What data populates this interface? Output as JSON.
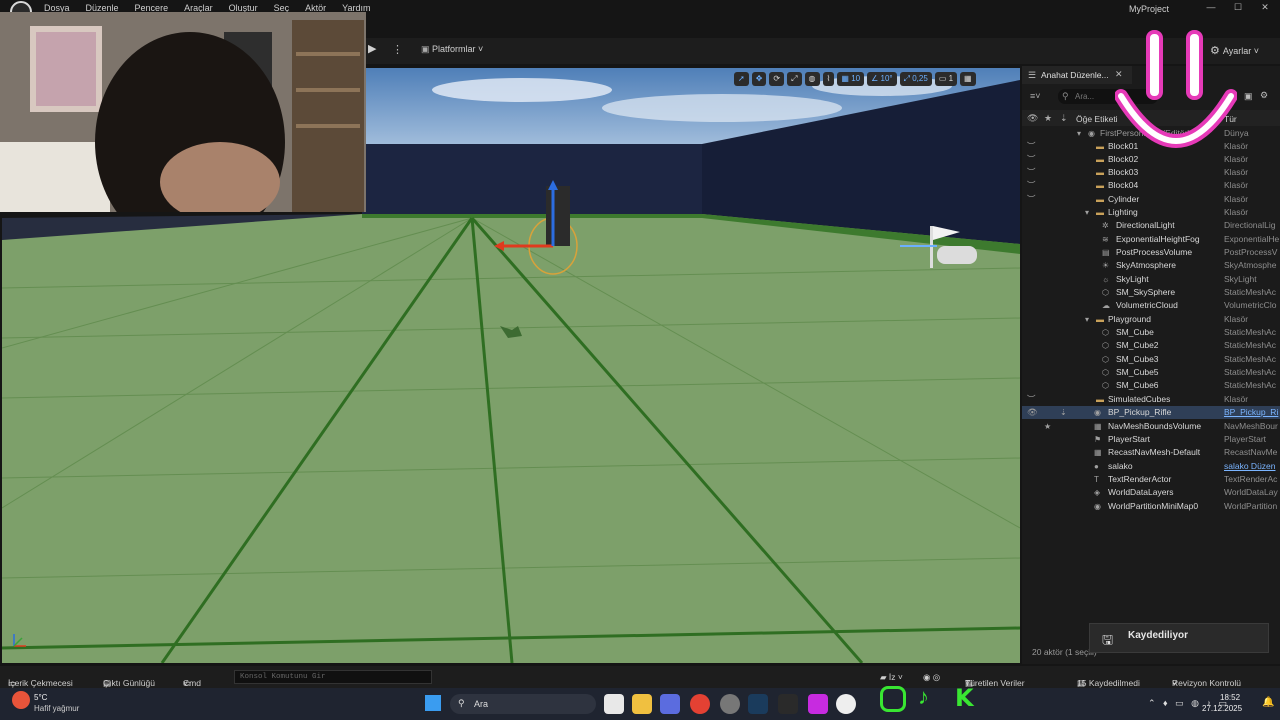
{
  "app": {
    "project_title": "MyProject",
    "menu": [
      "Dosya",
      "Düzenle",
      "Pencere",
      "Araçlar",
      "Oluştur",
      "Seç",
      "Aktör",
      "Yardım"
    ],
    "window_controls": {
      "minimize": "—",
      "maximize": "☐",
      "close": "✕"
    }
  },
  "toolbar": {
    "platforms_label": "Platformlar",
    "settings_label": "Ayarlar"
  },
  "viewport": {
    "controls": {
      "grid_value": "10",
      "angle_value": "10°",
      "scale_value": "0,25",
      "camera_speed": "1"
    }
  },
  "outliner": {
    "tab_title": "Anahat Düzenle...",
    "search_placeholder": "Ara...",
    "col_label": "Öğe Etiketi",
    "col_type": "Tür",
    "rows": [
      {
        "label": "FirstPersonMap (Editör)",
        "type": "Dünya"
      },
      {
        "label": "Block01",
        "type": "Klasör"
      },
      {
        "label": "Block02",
        "type": "Klasör"
      },
      {
        "label": "Block03",
        "type": "Klasör"
      },
      {
        "label": "Block04",
        "type": "Klasör"
      },
      {
        "label": "Cylinder",
        "type": "Klasör"
      },
      {
        "label": "Lighting",
        "type": "Klasör"
      },
      {
        "label": "DirectionalLight",
        "type": "DirectionalLig"
      },
      {
        "label": "ExponentialHeightFog",
        "type": "ExponentialHe"
      },
      {
        "label": "PostProcessVolume",
        "type": "PostProcessV"
      },
      {
        "label": "SkyAtmosphere",
        "type": "SkyAtmosphe"
      },
      {
        "label": "SkyLight",
        "type": "SkyLight"
      },
      {
        "label": "SM_SkySphere",
        "type": "StaticMeshAc"
      },
      {
        "label": "VolumetricCloud",
        "type": "VolumetricClo"
      },
      {
        "label": "Playground",
        "type": "Klasör"
      },
      {
        "label": "SM_Cube",
        "type": "StaticMeshAc"
      },
      {
        "label": "SM_Cube2",
        "type": "StaticMeshAc"
      },
      {
        "label": "SM_Cube3",
        "type": "StaticMeshAc"
      },
      {
        "label": "SM_Cube5",
        "type": "StaticMeshAc"
      },
      {
        "label": "SM_Cube6",
        "type": "StaticMeshAc"
      },
      {
        "label": "SimulatedCubes",
        "type": "Klasör"
      },
      {
        "label": "BP_Pickup_Rifle",
        "type": "BP_Pickup_Ri"
      },
      {
        "label": "NavMeshBoundsVolume",
        "type": "NavMeshBour"
      },
      {
        "label": "PlayerStart",
        "type": "PlayerStart"
      },
      {
        "label": "RecastNavMesh-Default",
        "type": "RecastNavMe"
      },
      {
        "label": "salako",
        "type": "salako Düzen"
      },
      {
        "label": "TextRenderActor",
        "type": "TextRenderAc"
      },
      {
        "label": "WorldDataLayers",
        "type": "WorldDataLay"
      },
      {
        "label": "WorldPartitionMiniMap0",
        "type": "WorldPartition"
      }
    ],
    "status": "20 aktör (1 seçili)"
  },
  "toast": {
    "label": "Kaydediliyor"
  },
  "bottom": {
    "content_drawer": "İçerik Çekmecesi",
    "output_log": "Çıktı Günlüğü",
    "cmd": "Cmd",
    "console_placeholder": "Konsol Komutunu Gir",
    "derived_data": "Türetilen Veriler",
    "unsaved": "15 Kaydedilmedi",
    "revision": "Revizyon Kontrolü"
  },
  "taskbar": {
    "weather_temp": "5°C",
    "weather_desc": "Hafif yağmur",
    "search": "Ara",
    "time": "18:52",
    "date": "27.12.2025"
  },
  "colors": {
    "selection": "#2f3f57",
    "accent": "#6cb0ff",
    "floor": "#7da06a"
  }
}
